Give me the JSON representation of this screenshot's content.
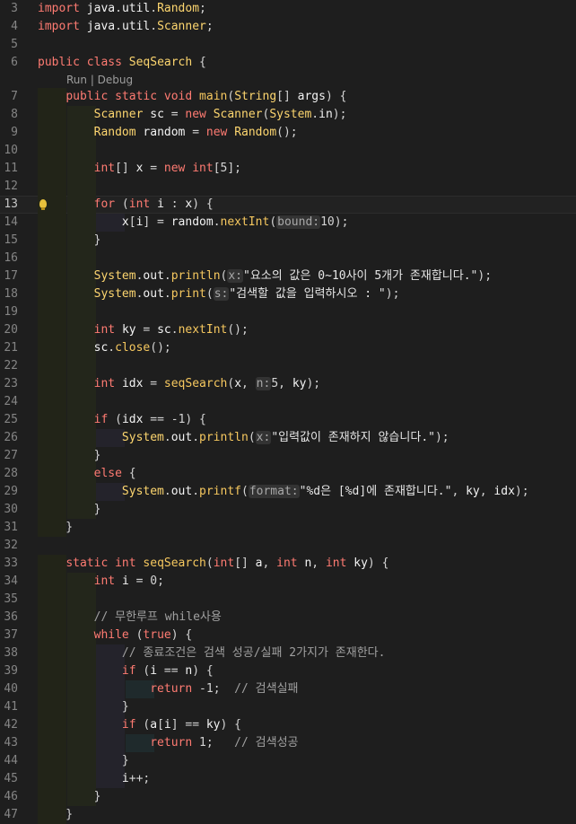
{
  "editor": {
    "language": "java",
    "codelens": "Run | Debug",
    "lines": [
      {
        "n": "3",
        "text": "import java.util.Random;"
      },
      {
        "n": "4",
        "text": "import java.util.Scanner;"
      },
      {
        "n": "5",
        "text": ""
      },
      {
        "n": "6",
        "text": "public class SeqSearch {"
      },
      {
        "n": "7",
        "text": "    public static void main(String[] args) {"
      },
      {
        "n": "8",
        "text": "        Scanner sc = new Scanner(System.in);"
      },
      {
        "n": "9",
        "text": "        Random random = new Random();"
      },
      {
        "n": "10",
        "text": ""
      },
      {
        "n": "11",
        "text": "        int[] x = new int[5];"
      },
      {
        "n": "12",
        "text": ""
      },
      {
        "n": "13",
        "text": "        for (int i : x) {"
      },
      {
        "n": "14",
        "text": "            x[i] = random.nextInt(bound:10);"
      },
      {
        "n": "15",
        "text": "        }"
      },
      {
        "n": "16",
        "text": ""
      },
      {
        "n": "17",
        "text": "        System.out.println(x:\"요소의 값은 0~10사이 5개가 존재합니다.\");"
      },
      {
        "n": "18",
        "text": "        System.out.print(s:\"검색할 값을 입력하시오 : \");"
      },
      {
        "n": "19",
        "text": ""
      },
      {
        "n": "20",
        "text": "        int ky = sc.nextInt();"
      },
      {
        "n": "21",
        "text": "        sc.close();"
      },
      {
        "n": "22",
        "text": ""
      },
      {
        "n": "23",
        "text": "        int idx = seqSearch(x, n:5, ky);"
      },
      {
        "n": "24",
        "text": ""
      },
      {
        "n": "25",
        "text": "        if (idx == -1) {"
      },
      {
        "n": "26",
        "text": "            System.out.println(x:\"입력값이 존재하지 않습니다.\");"
      },
      {
        "n": "27",
        "text": "        }"
      },
      {
        "n": "28",
        "text": "        else {"
      },
      {
        "n": "29",
        "text": "            System.out.printf(format:\"%d은 [%d]에 존재합니다.\", ky, idx);"
      },
      {
        "n": "30",
        "text": "        }"
      },
      {
        "n": "31",
        "text": "    }"
      },
      {
        "n": "32",
        "text": ""
      },
      {
        "n": "33",
        "text": "    static int seqSearch(int[] a, int n, int ky) {"
      },
      {
        "n": "34",
        "text": "        int i = 0;"
      },
      {
        "n": "35",
        "text": ""
      },
      {
        "n": "36",
        "text": "        // 무한루프 while사용"
      },
      {
        "n": "37",
        "text": "        while (true) {"
      },
      {
        "n": "38",
        "text": "            // 종료조건은 검색 성공/실패 2가지가 존재한다."
      },
      {
        "n": "39",
        "text": "            if (i == n) {"
      },
      {
        "n": "40",
        "text": "                return -1;  // 검색실패"
      },
      {
        "n": "41",
        "text": "            }"
      },
      {
        "n": "42",
        "text": "            if (a[i] == ky) {"
      },
      {
        "n": "43",
        "text": "                return 1;   // 검색성공"
      },
      {
        "n": "44",
        "text": "            }"
      },
      {
        "n": "45",
        "text": "            i++;"
      },
      {
        "n": "46",
        "text": "        }"
      },
      {
        "n": "47",
        "text": "    }"
      }
    ],
    "current_line": "13"
  }
}
